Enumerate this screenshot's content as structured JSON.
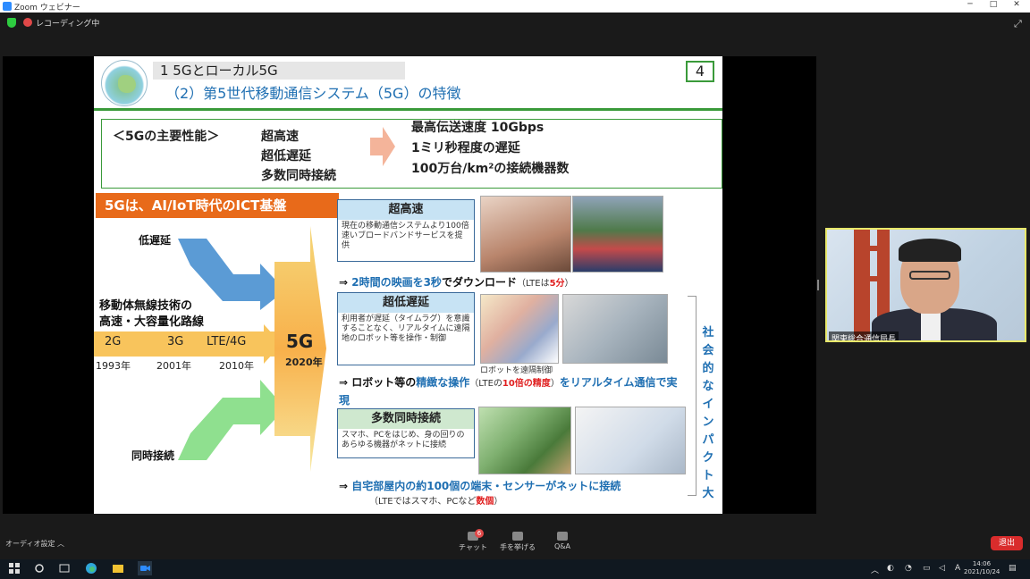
{
  "window": {
    "title": "Zoom ウェビナー",
    "minimize": "─",
    "maximize": "□",
    "close": "✕"
  },
  "status": {
    "recording_label": "レコーディング中"
  },
  "slide": {
    "title1": "1  5Gとローカル5G",
    "title2": "（2）第5世代移動通信システム（5G）の特徴",
    "page_number": "4",
    "perf": {
      "header": "＜5Gの主要性能＞",
      "items": [
        "超高速",
        "超低遅延",
        "多数同時接続"
      ],
      "values": [
        "最高伝送速度  10Gbps",
        "1ミリ秒程度の遅延",
        "100万台/km²の接続機器数"
      ]
    },
    "banner": "5Gは、AI/IoT時代のICT基盤",
    "left": {
      "low_latency": "低遅延",
      "mobile_line1": "移動体無線技術の",
      "mobile_line2": "高速・大容量化路線",
      "simultaneous": "同時接続",
      "timeline": [
        {
          "label": "2G",
          "year": "1993年"
        },
        {
          "label": "3G",
          "year": "2001年"
        },
        {
          "label": "LTE/4G",
          "year": "2010年"
        }
      ],
      "fiveg": "5G",
      "fiveg_year": "2020年"
    },
    "categories": [
      {
        "head": "超高速",
        "body": "現在の移動通信システムより100倍速いブロードバンドサービスを提供",
        "result_prefix": "⇒ ",
        "result_blue": "2時間の映画を3秒",
        "result_black": "でダウンロード",
        "result_note_open": "（LTEは",
        "result_note_red": "5分",
        "result_note_close": "）"
      },
      {
        "head": "超低遅延",
        "body": "利用者が遅延（タイムラグ）を意識することなく、リアルタイムに遠隔地のロボット等を操作・制御",
        "result_prefix": "⇒ ",
        "result_black": "ロボット等の",
        "result_blue": "精緻な操作",
        "result_note_open": "（LTEの",
        "result_note_red": "10倍の精度",
        "result_note_close": "）",
        "result_tail": "をリアルタイム通信で実現"
      },
      {
        "head": "多数同時接続",
        "body": "スマホ、PCをはじめ、身の回りのあらゆる機器がネットに接続",
        "result_prefix": "⇒ ",
        "result_blue": "自宅部屋内の約100個の端末・センサーがネットに接続",
        "result_note_open": "（LTEではスマホ、PCなど",
        "result_note_red": "数個",
        "result_note_close": "）"
      }
    ],
    "robot_caption": "ロボットを遠隔制御",
    "social_impact": [
      "社",
      "会",
      "的",
      "な",
      "イ",
      "ン",
      "パ",
      "ク",
      "ト",
      "大"
    ]
  },
  "video": {
    "participant_name": "関東総合通信局長"
  },
  "controls": {
    "audio_settings": "オーディオ設定 ︿",
    "chat": "チャット",
    "chat_badge": "6",
    "raise_hand": "手を挙げる",
    "qa": "Q&A",
    "leave": "退出"
  },
  "taskbar": {
    "time": "14:06",
    "date": "2021/10/24",
    "ime": "A"
  },
  "colors": {
    "accent_blue": "#1f6fb2",
    "accent_green": "#3a9a3a",
    "banner_orange": "#e86a1a",
    "red": "#e02020"
  }
}
